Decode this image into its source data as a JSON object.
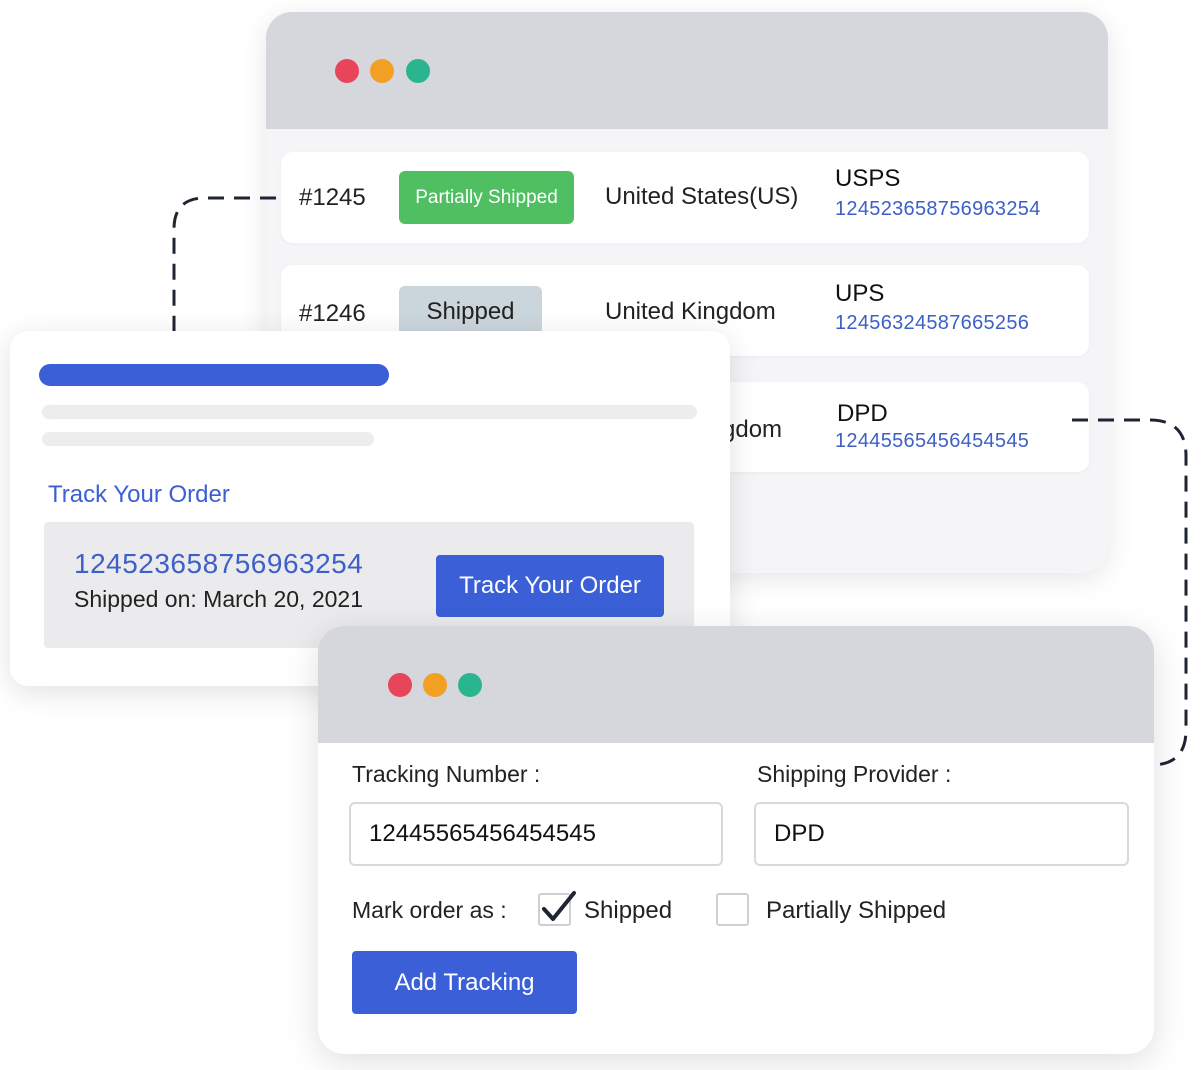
{
  "colors": {
    "dot_red": "#e8455a",
    "dot_orange": "#f2a023",
    "dot_green": "#2bb58f",
    "accent_blue": "#3a5fd6",
    "link_blue": "#3e5fc7",
    "badge_green": "#4fbf62",
    "badge_grey": "#cbd5dc"
  },
  "orders": [
    {
      "id": "#1245",
      "status": "Partially Shipped",
      "country": "United States(US)",
      "carrier": "USPS",
      "tracking": "124523658756963254"
    },
    {
      "id": "#1246",
      "status": "Shipped",
      "country": "United Kingdom",
      "carrier": "UPS",
      "tracking": "12456324587665256"
    },
    {
      "country_visible": "gdom",
      "carrier": "DPD",
      "tracking": "12445565456454545"
    }
  ],
  "track": {
    "heading": "Track Your Order",
    "tracking_number": "124523658756963254",
    "shipped_on_label": "Shipped on:",
    "shipped_on_date": "March 20, 2021",
    "button_label": "Track Your Order"
  },
  "form": {
    "tracking_label": "Tracking Number :",
    "tracking_value": "12445565456454545",
    "provider_label": "Shipping Provider :",
    "provider_value": "DPD",
    "mark_label": "Mark order as :",
    "option_shipped": "Shipped",
    "option_shipped_checked": true,
    "option_partial": "Partially Shipped",
    "option_partial_checked": false,
    "submit_label": "Add Tracking"
  }
}
